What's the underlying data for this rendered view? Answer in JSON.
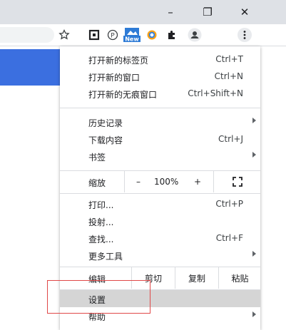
{
  "window_controls": {
    "minimize": "–",
    "restore": "❐",
    "close": "✕"
  },
  "toolbar_icons": [
    "star-icon",
    "square-extension-icon",
    "parking-icon",
    "new-badge-extension-icon",
    "opera-icon",
    "puzzle-icon",
    "profile-icon",
    "more-icon"
  ],
  "toolbar_badge": "New",
  "menu": {
    "group1": [
      {
        "label": "打开新的标签页",
        "shortcut": "Ctrl+T"
      },
      {
        "label": "打开新的窗口",
        "shortcut": "Ctrl+N"
      },
      {
        "label": "打开新的无痕窗口",
        "shortcut": "Ctrl+Shift+N"
      }
    ],
    "group2": [
      {
        "label": "历史记录",
        "submenu": true
      },
      {
        "label": "下载内容",
        "shortcut": "Ctrl+J"
      },
      {
        "label": "书签",
        "submenu": true
      }
    ],
    "zoom": {
      "label": "缩放",
      "minus": "–",
      "value": "100%",
      "plus": "+",
      "fullscreen": "⛶"
    },
    "group3": [
      {
        "label": "打印...",
        "shortcut": "Ctrl+P"
      },
      {
        "label": "投射..."
      },
      {
        "label": "查找...",
        "shortcut": "Ctrl+F"
      },
      {
        "label": "更多工具",
        "submenu": true
      }
    ],
    "edit": {
      "label": "编辑",
      "cut": "剪切",
      "copy": "复制",
      "paste": "粘贴"
    },
    "group4": [
      {
        "label": "设置"
      },
      {
        "label": "帮助",
        "submenu": true
      }
    ]
  },
  "colors": {
    "banner": "#3b6fe0",
    "highlight": "#d5d5d5",
    "annotation": "#e04848"
  }
}
